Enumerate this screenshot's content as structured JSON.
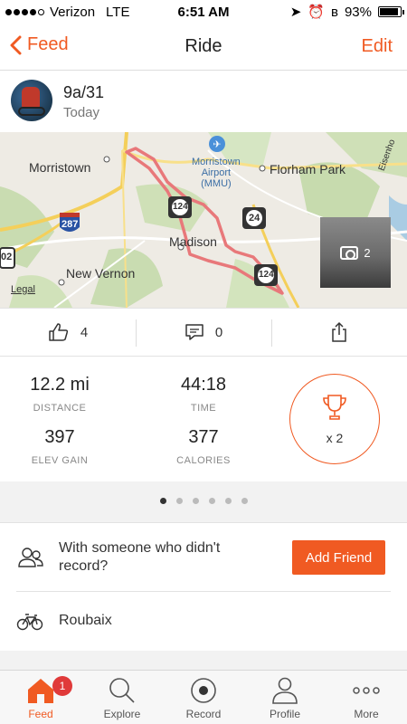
{
  "status_bar": {
    "carrier": "Verizon",
    "network": "LTE",
    "time": "6:51 AM",
    "battery": "93%",
    "battery_level": 0.93
  },
  "nav": {
    "back_label": "Feed",
    "title": "Ride",
    "edit_label": "Edit"
  },
  "activity": {
    "title": "9a/31",
    "date": "Today"
  },
  "map": {
    "labels": {
      "morristown": "Morristown",
      "airport": "Morristown\nAirport\n(MMU)",
      "florham_park": "Florham Park",
      "madison": "Madison",
      "new_vernon": "New Vernon",
      "legal": "Legal",
      "eisenhower": "Eisenho",
      "route_287": "287",
      "route_124a": "124",
      "route_24": "24",
      "route_124b": "124",
      "route_202": "02"
    },
    "photo_count": "2"
  },
  "actions": {
    "kudos_count": "4",
    "comments_count": "0"
  },
  "stats": [
    {
      "value": "12.2 mi",
      "label": "DISTANCE"
    },
    {
      "value": "44:18",
      "label": "TIME"
    },
    {
      "value": "397",
      "label": "ELEV GAIN"
    },
    {
      "value": "377",
      "label": "CALORIES"
    }
  ],
  "trophy": {
    "count": "x 2"
  },
  "pager": {
    "pages": 6,
    "active": 0
  },
  "friend_prompt": {
    "text": "With someone who didn't record?",
    "button": "Add Friend"
  },
  "bike": {
    "name": "Roubaix"
  },
  "tabs": [
    {
      "label": "Feed",
      "badge": "1"
    },
    {
      "label": "Explore"
    },
    {
      "label": "Record"
    },
    {
      "label": "Profile"
    },
    {
      "label": "More"
    }
  ],
  "colors": {
    "accent": "#f05a22",
    "badge": "#e03a3a",
    "route": "#e8787a"
  }
}
